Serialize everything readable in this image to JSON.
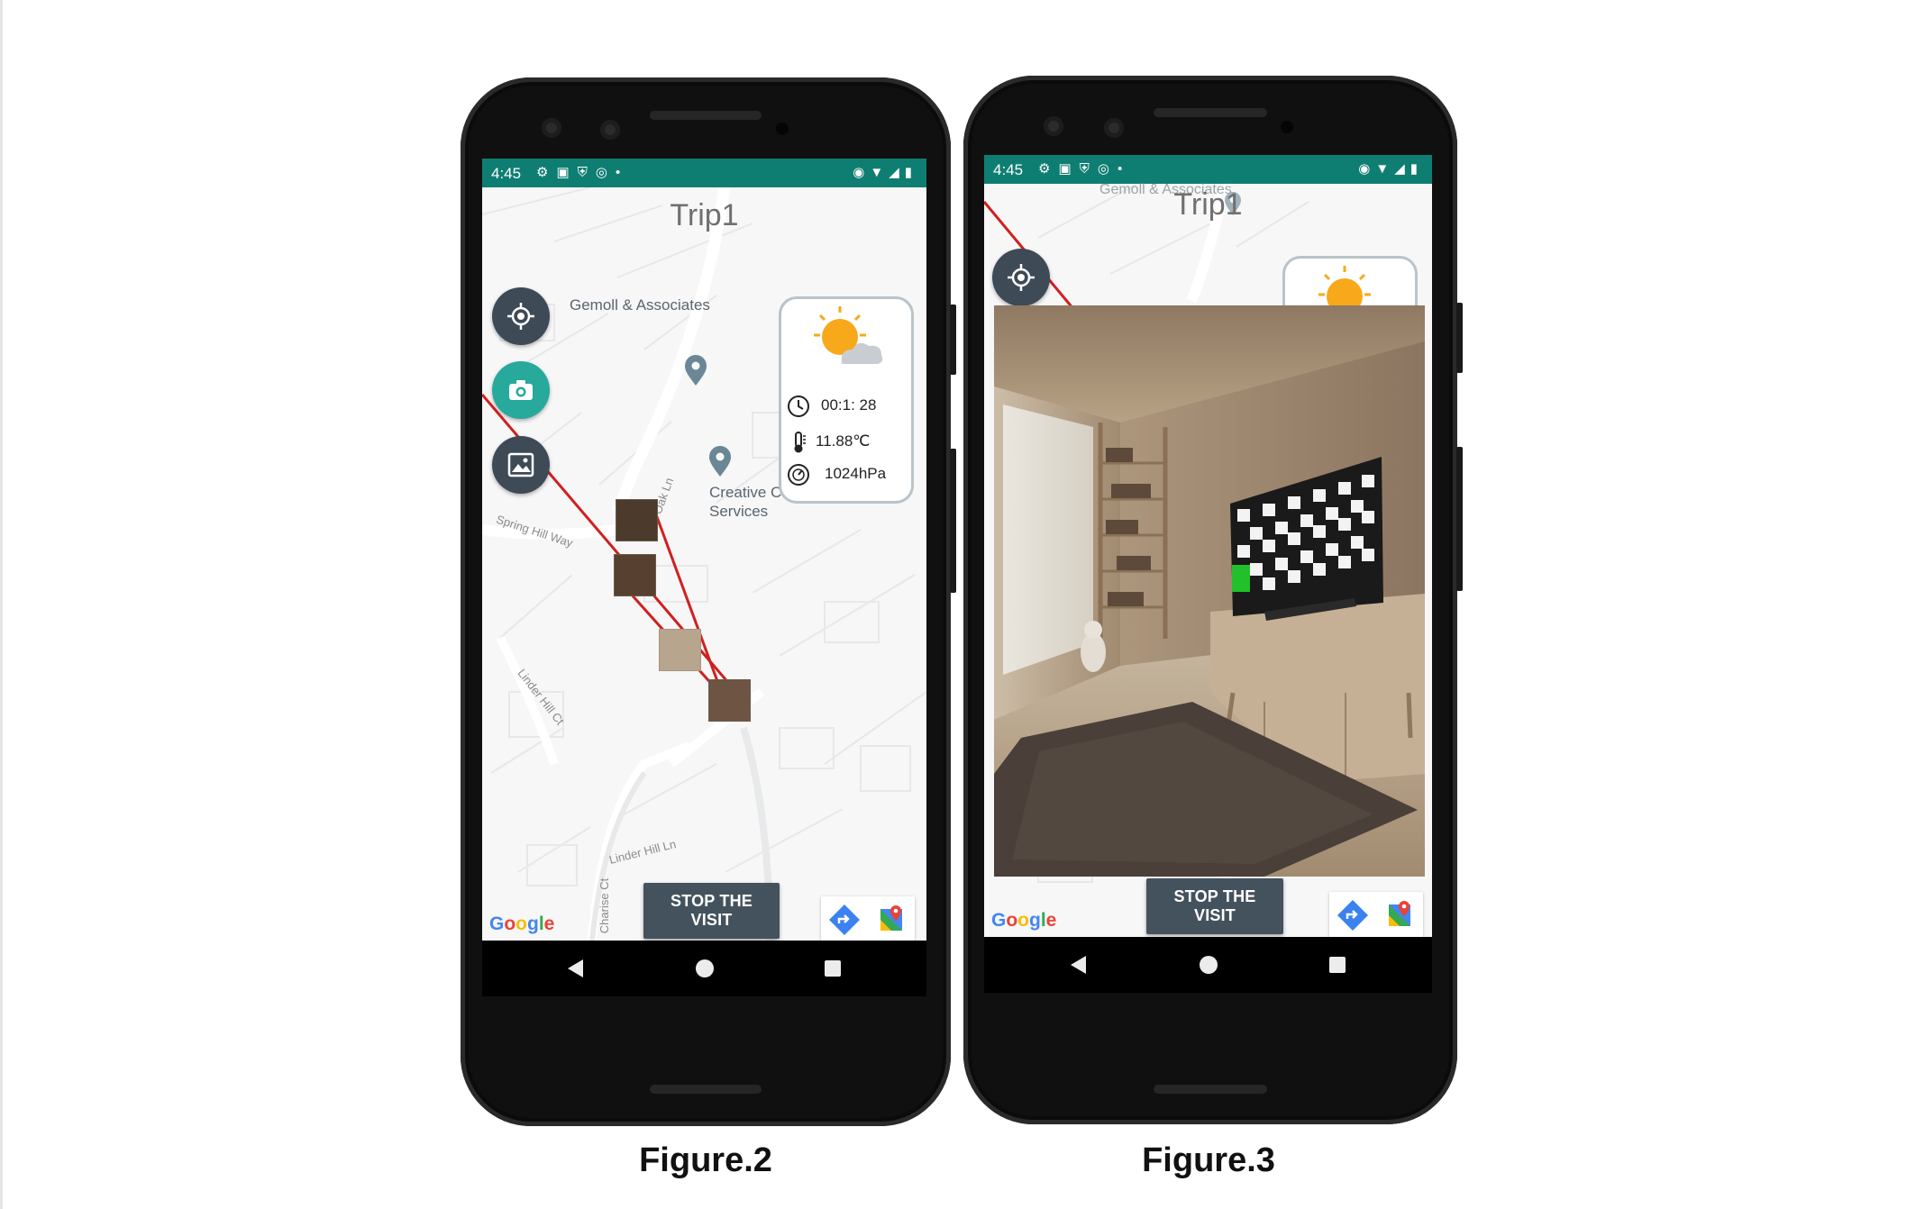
{
  "figures": [
    {
      "caption": "Figure.2",
      "status_time": "4:45",
      "trip_title": "Trip1",
      "weather": {
        "elapsed": "00:1: 28",
        "temperature": "11.88℃",
        "pressure": "1024hPa"
      },
      "poi": {
        "gemoll": "Gemoll & Associates",
        "creative_line1": "Creative Consulting",
        "creative_line2": "Services"
      },
      "streets": {
        "spring_hill": "Spring Hill Way",
        "linder_hill_ct": "Linder Hill Ct",
        "linder_hill_ln": "Linder Hill Ln",
        "charise_ct": "Charise Ct",
        "oak_ln": "Oak Ln"
      },
      "stop_button": "STOP THE VISIT",
      "google_letters": [
        "G",
        "o",
        "o",
        "g",
        "l",
        "e"
      ]
    },
    {
      "caption": "Figure.3",
      "status_time": "4:45",
      "trip_title": "Trip1",
      "poi_gemoll": "Gemoll & Associates",
      "stop_button": "STOP THE VISIT",
      "google_letters": [
        "G",
        "o",
        "o",
        "g",
        "l",
        "e"
      ]
    }
  ],
  "icons": {
    "fab_locate": "crosshair-icon",
    "fab_camera": "camera-icon",
    "fab_gallery": "image-gallery-icon",
    "weather": "sun-cloud-icon",
    "clock": "clock-icon",
    "thermometer": "thermometer-icon",
    "pressure": "gauge-icon",
    "map_pin": "map-pin-icon",
    "directions": "directions-icon",
    "maps": "google-maps-icon",
    "nav_back": "back-triangle-icon",
    "nav_home": "home-circle-icon",
    "nav_recents": "recents-square-icon"
  },
  "colors": {
    "status_bar": "#0f7e72",
    "fab_dark": "#3e4a56",
    "fab_teal": "#27a99c",
    "route_line": "#d11f1f",
    "stop_button": "#44525d",
    "sun": "#f7a91b"
  }
}
